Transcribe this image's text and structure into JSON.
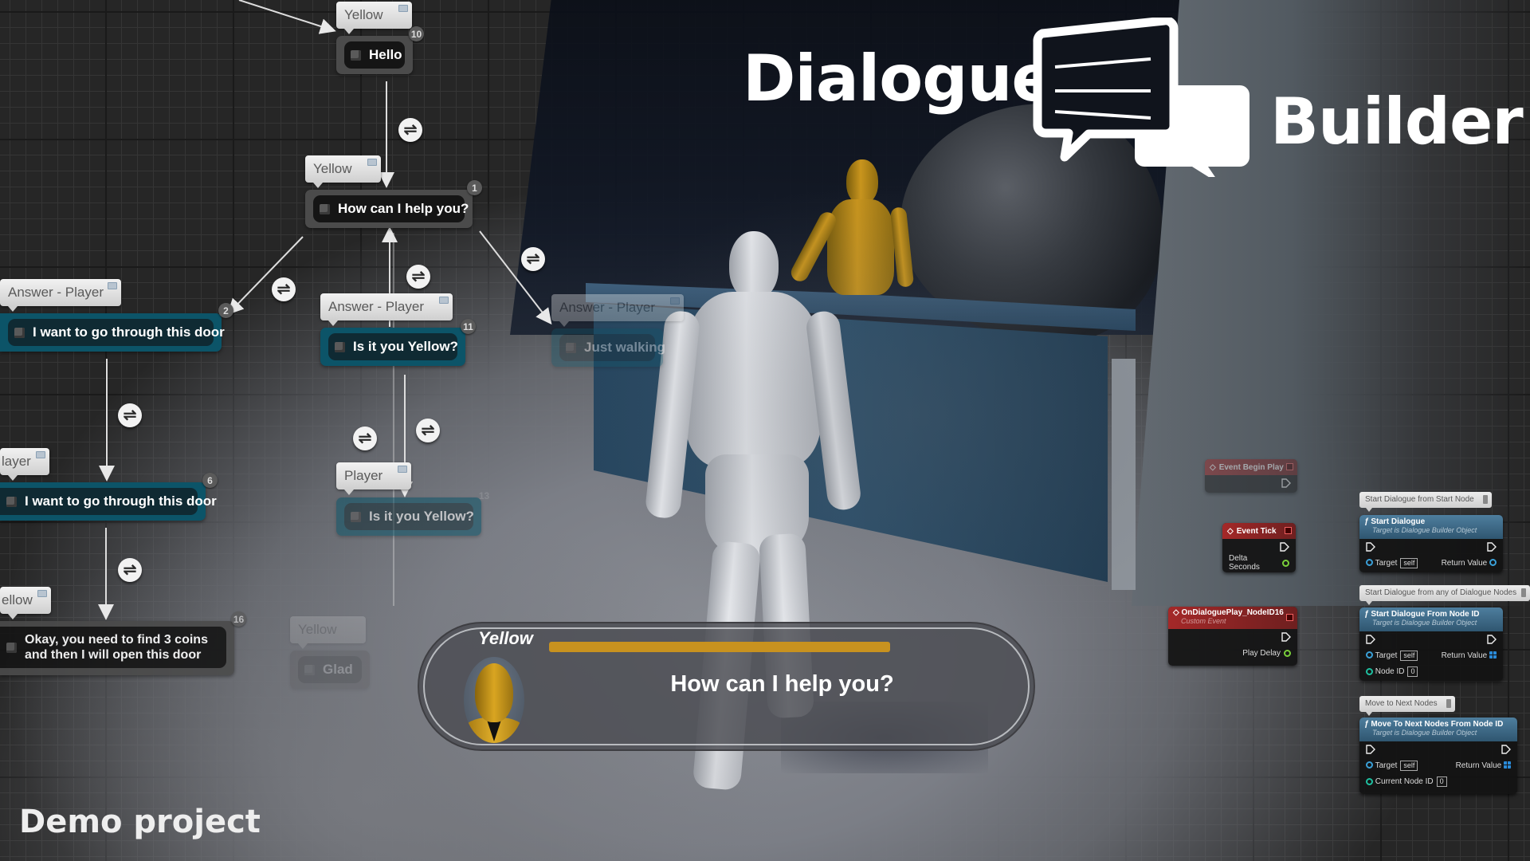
{
  "title": {
    "word1": "Dialogue",
    "word2": "Builder",
    "logo_icon": "speech-bubbles-icon"
  },
  "footer": {
    "label": "Demo project"
  },
  "graph": {
    "nodes": [
      {
        "speaker": "Yellow",
        "text": "Hello",
        "id": "10",
        "kind": "npc"
      },
      {
        "speaker": "Yellow",
        "text": "How can I help you?",
        "id": "1",
        "kind": "npc"
      },
      {
        "speaker": "Answer - Player",
        "text": "I want to go through this door",
        "id": "2",
        "kind": "player"
      },
      {
        "speaker": "Answer - Player",
        "text": "Is it you Yellow?",
        "id": "11",
        "kind": "player"
      },
      {
        "speaker": "Answer - Player",
        "text": "Just walking",
        "id": "",
        "kind": "player"
      },
      {
        "speaker": "layer",
        "text": "I want to go through this door",
        "id": "6",
        "kind": "player"
      },
      {
        "speaker": "Player",
        "text": "Is it you Yellow?",
        "id": "13",
        "kind": "player"
      },
      {
        "speaker": "ellow",
        "text": "Okay, you need to find 3 coins and then I will open this door",
        "id": "16",
        "kind": "npc"
      },
      {
        "speaker": "Yellow",
        "text": "Glad",
        "id": "",
        "kind": "npc"
      }
    ],
    "transition_icon": "transition-arrows-icon"
  },
  "dialogue_ui": {
    "speaker": "Yellow",
    "line": "How can I help you?",
    "timer_fraction": 1.0,
    "timer_color": "#c8921f",
    "portrait": "yellow-character-portrait"
  },
  "blueprint": {
    "events": [
      {
        "title": "Event Begin Play",
        "outputs": []
      },
      {
        "title": "Event Tick",
        "outputs": [
          "Delta Seconds"
        ]
      },
      {
        "title": "OnDialoguePlay_NodeID16",
        "subtitle": "Custom Event",
        "outputs": [
          "Play Delay"
        ]
      }
    ],
    "functions": [
      {
        "comment": "Start Dialogue from Start Node",
        "title": "Start Dialogue",
        "subtitle": "Target is Dialogue Builder Object",
        "target_label": "Target",
        "target_value": "self",
        "return_label": "Return Value",
        "extra_label": null,
        "extra_value": null
      },
      {
        "comment": "Start Dialogue from any of Dialogue Nodes",
        "title": "Start Dialogue From Node ID",
        "subtitle": "Target is Dialogue Builder Object",
        "target_label": "Target",
        "target_value": "self",
        "return_label": "Return Value",
        "extra_label": "Node ID",
        "extra_value": "0"
      },
      {
        "comment": "Move to Next Nodes",
        "title": "Move To Next Nodes From Node ID",
        "subtitle": "Target is Dialogue Builder Object",
        "target_label": "Target",
        "target_value": "self",
        "return_label": "Return Value",
        "extra_label": "Current Node ID",
        "extra_value": "0"
      }
    ]
  },
  "colors": {
    "npc_node": "#4b4b4b",
    "player_node": "#0c5468",
    "event_header": "#a42828",
    "function_header": "#4e7e9e"
  }
}
